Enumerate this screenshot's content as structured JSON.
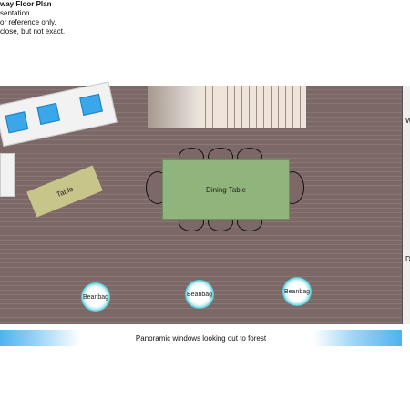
{
  "header": {
    "title": "way Floor Plan",
    "line1": "sentation.",
    "line2": "or reference only.",
    "line3": "close, but not exact."
  },
  "labels": {
    "table": "Table",
    "dining_table": "Dining Table",
    "beanbag_1": "Beanbag",
    "beanbag_2": "Beanbag",
    "beanbag_3": "Beanbag",
    "windows": "Panoramic windows looking out to forest"
  },
  "right_wall": {
    "w": "W",
    "d": "D"
  },
  "colors": {
    "floor": "#7c6866",
    "dining_table": "#8fb57c",
    "small_table": "#c8c58a",
    "sofa_cushion": "#3aa7ea",
    "window_blue": "#4fb2f0",
    "beanbag_rim": "#3fc3cc"
  }
}
